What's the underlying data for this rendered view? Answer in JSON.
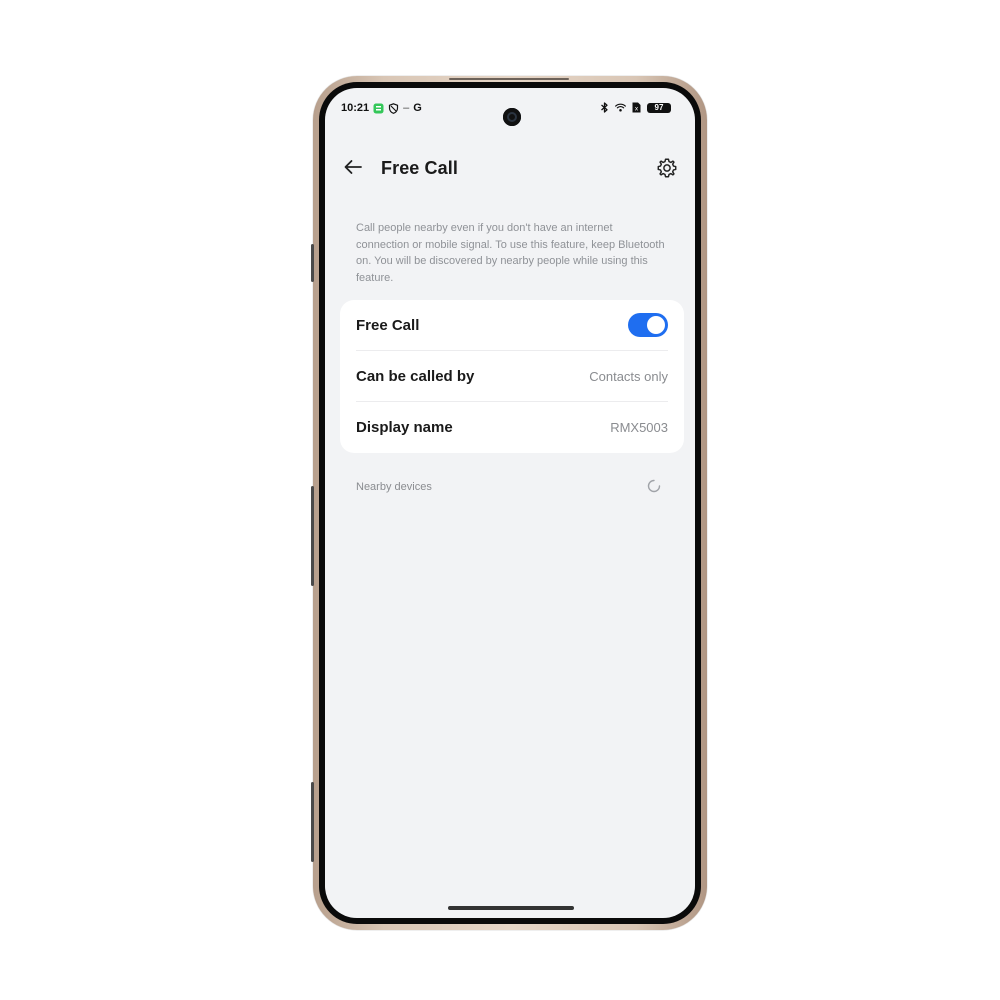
{
  "status_bar": {
    "time": "10:21",
    "g_label": "G",
    "dash": "–",
    "battery_level": "97",
    "icons": [
      "app-notification-icon",
      "shield-icon",
      "bluetooth-icon",
      "wifi-icon",
      "sim-icon",
      "battery-icon"
    ]
  },
  "header": {
    "title": "Free Call",
    "back_icon": "arrow-left-icon",
    "settings_icon": "gear-icon"
  },
  "description": "Call people nearby even if you don't have an internet connection or mobile signal. To use this feature, keep Bluetooth on. You will be discovered by nearby people while using this feature.",
  "settings": {
    "free_call": {
      "label": "Free Call",
      "enabled": true
    },
    "can_be_called_by": {
      "label": "Can be called by",
      "value": "Contacts only"
    },
    "display_name": {
      "label": "Display name",
      "value": "RMX5003"
    }
  },
  "nearby_devices": {
    "label": "Nearby devices",
    "loading_icon": "spinner-icon"
  },
  "colors": {
    "accent": "#1f6ef0",
    "background": "#f2f3f5",
    "card": "#ffffff",
    "secondary_text": "#8a8c90"
  }
}
